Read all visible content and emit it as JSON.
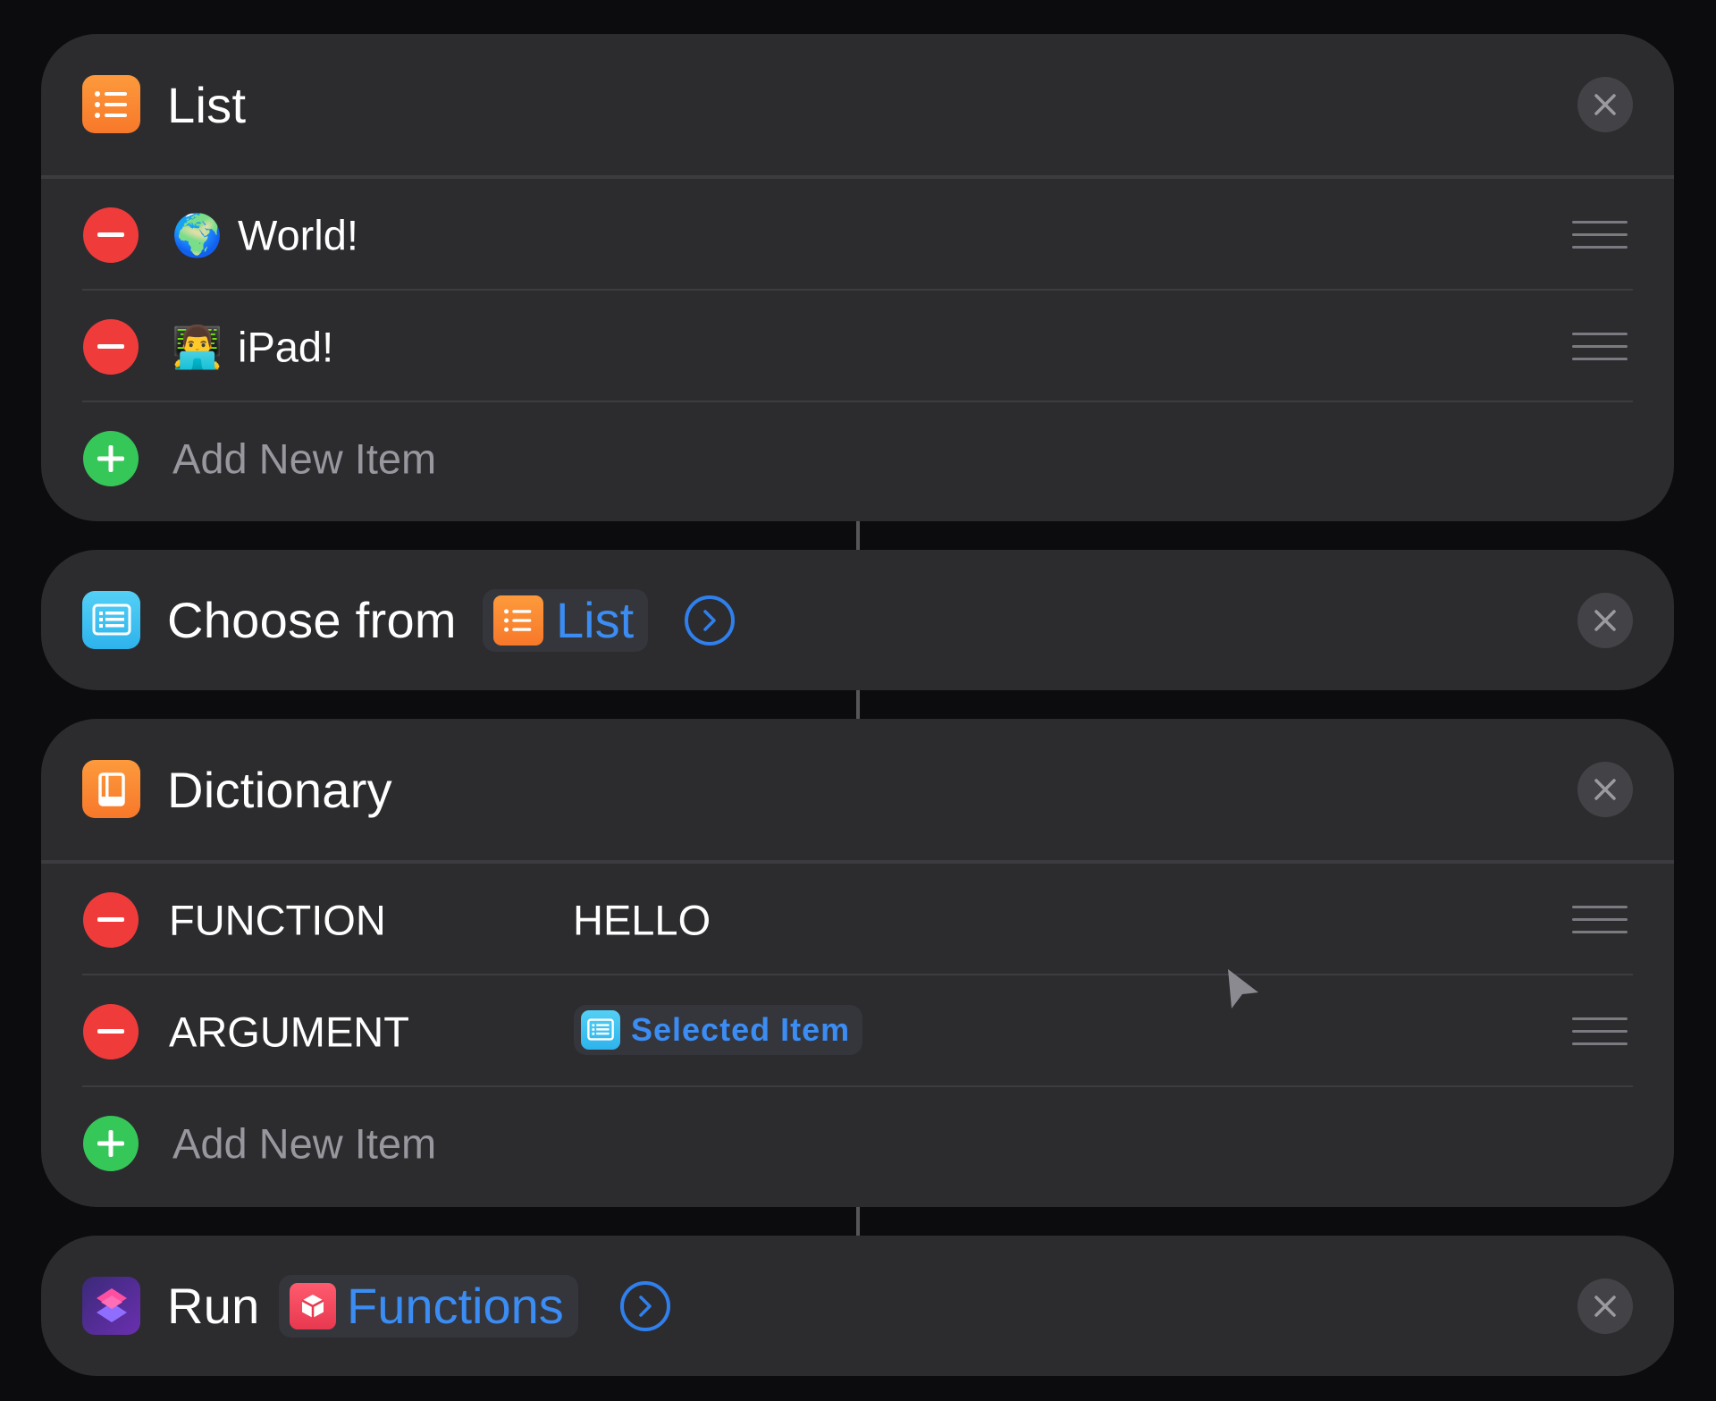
{
  "list_action": {
    "title": "List",
    "items": [
      {
        "emoji": "🌍",
        "label": "World!"
      },
      {
        "emoji": "👨‍💻",
        "label": "iPad!"
      }
    ],
    "add_label": "Add New Item"
  },
  "choose_action": {
    "title": "Choose from",
    "token_label": "List"
  },
  "dictionary_action": {
    "title": "Dictionary",
    "entries": [
      {
        "key": "FUNCTION",
        "value": "HELLO"
      },
      {
        "key": "ARGUMENT",
        "value_token": "Selected Item"
      }
    ],
    "add_label": "Add New Item"
  },
  "run_action": {
    "title": "Run",
    "token_label": "Functions"
  },
  "colors": {
    "background": "#0c0c0e",
    "card": "#2c2c2f",
    "accent_blue": "#3b8cf3",
    "remove_red": "#f03b3b",
    "add_green": "#36c759",
    "list_orange": "#fb8a2d",
    "choose_cyan": "#3ec1f1"
  }
}
